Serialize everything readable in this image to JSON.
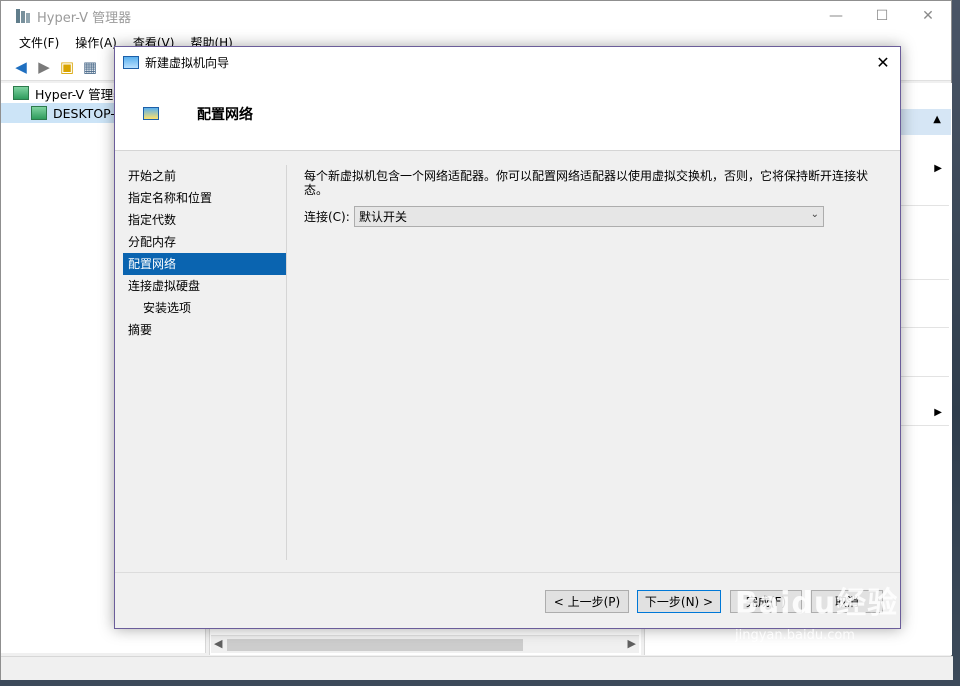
{
  "main_window": {
    "title": "Hyper-V 管理器",
    "controls": {
      "minimize": "—",
      "maximize": "☐",
      "close": "✕"
    },
    "menu": [
      "文件(F)",
      "操作(A)",
      "查看(V)",
      "帮助(H)"
    ],
    "tree": [
      {
        "label": "Hyper-V 管理器"
      },
      {
        "label": "DESKTOP-"
      }
    ]
  },
  "wizard": {
    "title": "新建虚拟机向导",
    "close": "✕",
    "header_title": "配置网络",
    "steps": [
      {
        "label": "开始之前",
        "active": false
      },
      {
        "label": "指定名称和位置",
        "active": false
      },
      {
        "label": "指定代数",
        "active": false
      },
      {
        "label": "分配内存",
        "active": false
      },
      {
        "label": "配置网络",
        "active": true
      },
      {
        "label": "连接虚拟硬盘",
        "active": false
      },
      {
        "label": "安装选项",
        "active": false
      },
      {
        "label": "摘要",
        "active": false
      }
    ],
    "description": "每个新虚拟机包含一个网络适配器。你可以配置网络适配器以使用虚拟交换机，否则，它将保持断开连接状态。",
    "connection_label": "连接(C):",
    "connection_value": "默认开关",
    "buttons": {
      "previous": "< 上一步(P)",
      "next": "下一步(N) >",
      "finish": "完成(F)",
      "cancel": "取消"
    }
  },
  "watermark": {
    "logo": "Baidu经验",
    "url": "jingyan.baidu.com"
  }
}
